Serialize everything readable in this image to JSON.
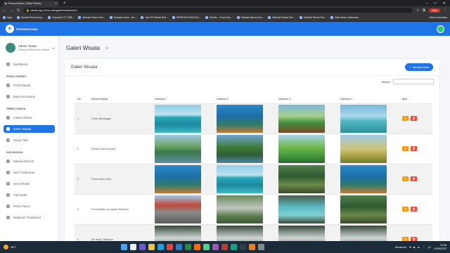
{
  "browser": {
    "tab_title": "PesonaToana | Galeri Wisata",
    "url": "wisata.app-demo.site/galeriwisata/index",
    "profile_chip": "Jeda",
    "bookmarks": [
      "Apps",
      "Website Resmi Dep...",
      "Rapoarti 273 7488...",
      "Website Resmi Des...",
      "Dynamic Drive - No...",
      "Jual HP Xiaomi Red...",
      "BERSTATUSMILIK/C...",
      "Kiloelin - Cloud Hos...",
      "Website Resmi Des...",
      "Website Resmi Des...",
      "Website Resmi Des...",
      "Web Desa | Indonesia"
    ],
    "bookmarks_other": "Other bookmarks"
  },
  "header": {
    "logo_text": "PESONATOANA"
  },
  "sidebar": {
    "user_name": "Admin Toana",
    "user_sub": "Wisbng Dest/ksd dan industri",
    "items": [
      {
        "label": "Dashboard",
        "active": false
      },
      {
        "section": "PROFIL DAERAH"
      },
      {
        "label": "Profil Daerah",
        "active": false
      },
      {
        "label": "Data Kecamatan",
        "active": false
      },
      {
        "section": "TEMPAT WISATA"
      },
      {
        "label": "Lokasi Wisata",
        "active": false
      },
      {
        "label": "Galeri Wisata",
        "active": true
      },
      {
        "label": "Harga Tiket",
        "active": false
      },
      {
        "section": "DATA BUDAYA"
      },
      {
        "label": "Bahasa Daerah",
        "active": false
      },
      {
        "label": "Seni Tradisional",
        "active": false
      },
      {
        "label": "Seni Disenik",
        "active": false
      },
      {
        "label": "Alat Musik",
        "active": false
      },
      {
        "label": "Pesta Panen",
        "active": false
      },
      {
        "label": "Makanan Tradisional",
        "active": false
      }
    ]
  },
  "main": {
    "page_title": "Galeri Wisata",
    "card_title": "Galeri Wisata",
    "add_button": "Tambah Data",
    "search_label": "Search:",
    "search_value": "",
    "columns": [
      "No",
      "Nama Wisata",
      "Gambar 1",
      "Gambar 2",
      "Gambar 3",
      "Gambar 4",
      "Aksi"
    ],
    "rows": [
      {
        "no": "1",
        "name": "Pulau Bollangga",
        "imgs": [
          "island",
          "reef",
          "cottage",
          "pier"
        ]
      },
      {
        "no": "2",
        "name": "Danau Gunung pola",
        "imgs": [
          "lake",
          "hills",
          "people",
          "savanna"
        ]
      },
      {
        "no": "3",
        "name": "Pulau buku buku",
        "imgs": [
          "reef",
          "island",
          "forest",
          "reef"
        ]
      },
      {
        "no": "4",
        "name": "Permandian air panas Moinoon",
        "imgs": [
          "gate",
          "river",
          "pool",
          "forest"
        ]
      },
      {
        "no": "5",
        "name": "Air terjun Tanimpa",
        "imgs": [
          "waterfall",
          "waterfall",
          "waterfall",
          "waterfall"
        ]
      }
    ]
  },
  "taskbar": {
    "weather": "28°C",
    "media": "Moramoni",
    "time": "10:38",
    "date": "24/05/2022"
  }
}
